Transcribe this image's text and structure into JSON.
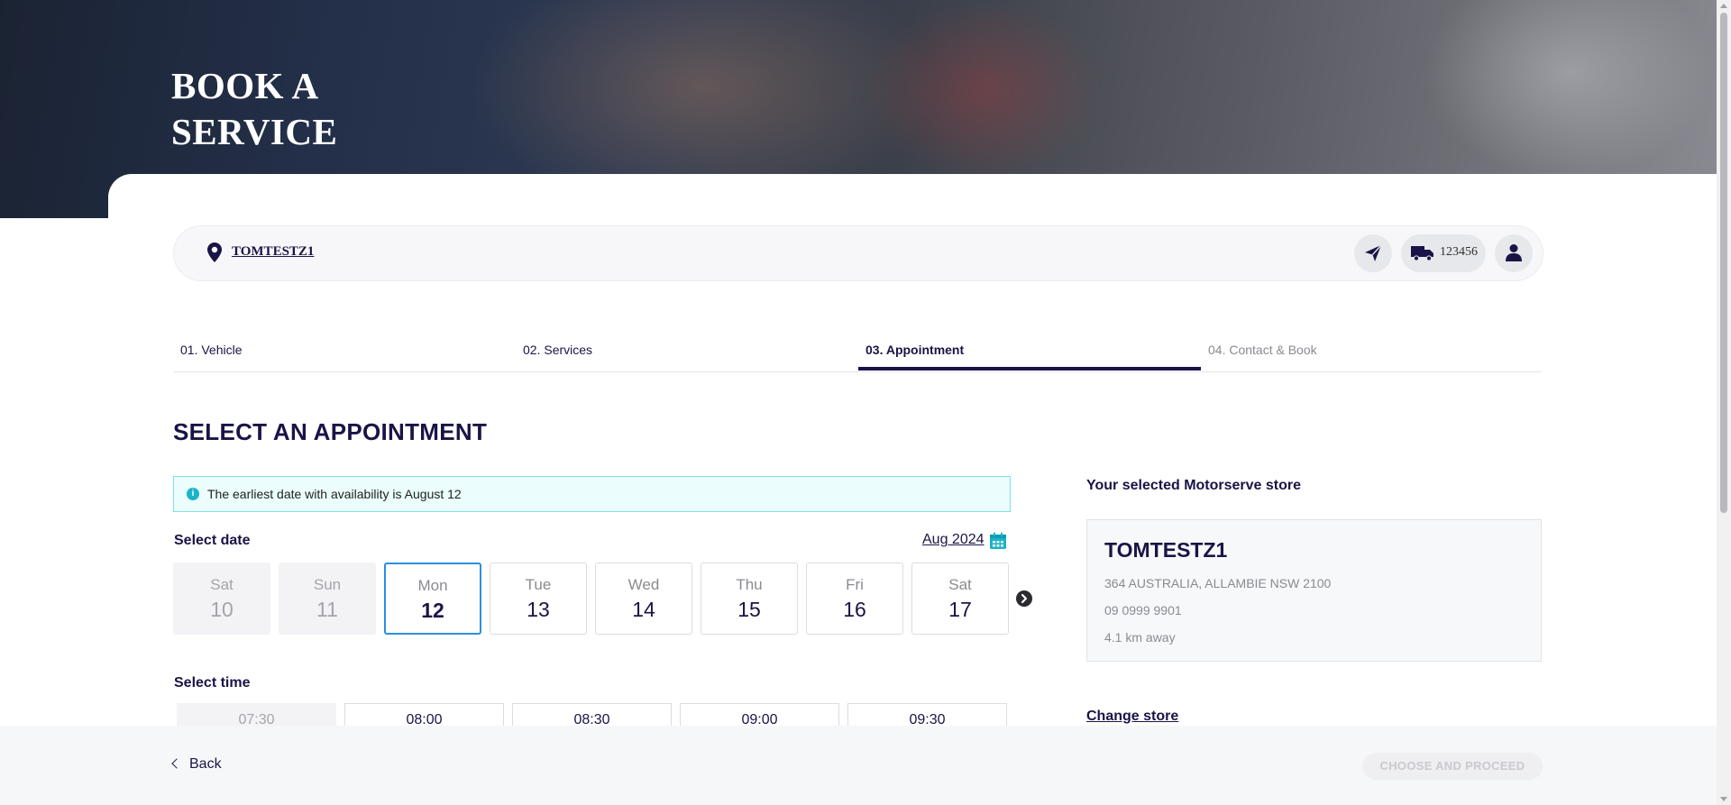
{
  "hero": {
    "title_line1": "BOOK A",
    "title_line2": "SERVICE"
  },
  "location_bar": {
    "store_name": "TOMTESTZ1",
    "vehicle_plate": "123456",
    "icons": [
      "map-pin-icon",
      "send-icon",
      "truck-icon",
      "user-icon"
    ]
  },
  "steps": [
    {
      "label": "01. Vehicle",
      "state": "done"
    },
    {
      "label": "02. Services",
      "state": "done"
    },
    {
      "label": "03. Appointment",
      "state": "active"
    },
    {
      "label": "04. Contact & Book",
      "state": "upcoming"
    }
  ],
  "appointment": {
    "title": "SELECT AN APPOINTMENT",
    "info_text": "The earliest date with availability is August 12",
    "select_date_label": "Select date",
    "month_label": "Aug 2024",
    "dates": [
      {
        "dow": "Sat",
        "day": "10",
        "state": "disabled"
      },
      {
        "dow": "Sun",
        "day": "11",
        "state": "disabled"
      },
      {
        "dow": "Mon",
        "day": "12",
        "state": "selected"
      },
      {
        "dow": "Tue",
        "day": "13",
        "state": "available"
      },
      {
        "dow": "Wed",
        "day": "14",
        "state": "available"
      },
      {
        "dow": "Thu",
        "day": "15",
        "state": "available"
      },
      {
        "dow": "Fri",
        "day": "16",
        "state": "available"
      },
      {
        "dow": "Sat",
        "day": "17",
        "state": "available"
      }
    ],
    "select_time_label": "Select time",
    "times": [
      {
        "time": "07:30",
        "state": "disabled"
      },
      {
        "time": "08:00",
        "state": "available"
      },
      {
        "time": "08:30",
        "state": "available"
      },
      {
        "time": "09:00",
        "state": "available"
      },
      {
        "time": "09:30",
        "state": "available"
      }
    ]
  },
  "store": {
    "heading": "Your selected Motorserve store",
    "name": "TOMTESTZ1",
    "address": "364 AUSTRALIA, ALLAMBIE NSW 2100",
    "phone": "09 0999 9901",
    "distance": "4.1 km away",
    "change_label": "Change store"
  },
  "footer": {
    "back_label": "Back",
    "proceed_label": "CHOOSE AND PROCEED"
  },
  "colors": {
    "brand_navy": "#1a1446",
    "selected_border": "#2c8fdd",
    "info_bg": "#ebfdfd",
    "info_border": "#7fe2ea",
    "calendar_accent": "#19b4c8"
  }
}
